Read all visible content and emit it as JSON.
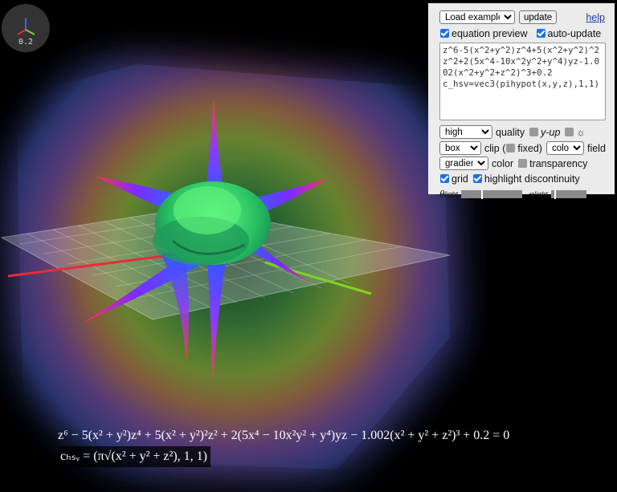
{
  "gizmo": {
    "scale_label": "0.2"
  },
  "panel": {
    "example_select": "Load example...",
    "update_label": "update",
    "help_label": "help",
    "equation_preview_label": "equation preview",
    "equation_preview_checked": true,
    "auto_update_label": "auto-update",
    "auto_update_checked": true,
    "equation_text": "z^6-5(x^2+y^2)z^4+5(x^2+y^2)^2z^2+2(5x^4-10x^2y^2+y^4)yz-1.002(x^2+y^2+z^2)^3+0.2\nc_hsv=vec3(pihypot(x,y,z),1,1)",
    "quality_select": "high",
    "quality_label": "quality",
    "y_up_label": "y-up",
    "y_up_checked": false,
    "light_checked": false,
    "clip_select": "box",
    "clip_label": "clip (",
    "fixed_label": "fixed)",
    "fixed_checked": false,
    "field_select": "color",
    "field_label": "field",
    "color_select": "gradient",
    "color_label": "color",
    "transparency_label": "transparency",
    "transparency_checked": false,
    "grid_label": "grid",
    "grid_checked": true,
    "highlight_label": "highlight discontinuity",
    "highlight_checked": true,
    "theta_label": "θ",
    "theta_sub": "light",
    "phi_label": "φ",
    "phi_sub": "light",
    "theta_value": 0.33,
    "phi_value": 0.1
  },
  "preview": {
    "line1": "z⁶ − 5(x² + y²)z⁴ + 5(x² + y²)²z² + 2(5x⁴ − 10x²y² + y⁴)yz − 1.002(x² + y² + z²)³ + 0.2 = 0",
    "line2": "cₕₛᵥ = (π√(x² + y² + z²), 1, 1)"
  },
  "colors": {
    "x_axis": "#e0303a",
    "y_axis": "#7ed321",
    "z_axis": "#2f6bff",
    "panel_bg": "#f5f5f5",
    "checkbox_on": "#1a73e8"
  }
}
